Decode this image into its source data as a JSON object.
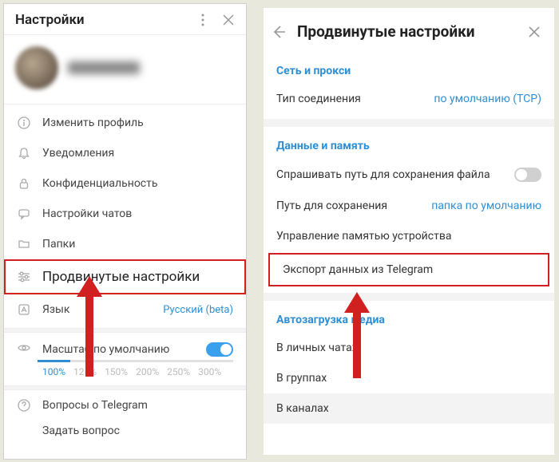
{
  "left": {
    "title": "Настройки",
    "items": {
      "edit_profile": "Изменить профиль",
      "notifications": "Уведомления",
      "privacy": "Конфиденциальность",
      "chat_settings": "Настройки чатов",
      "folders": "Папки",
      "advanced": "Продвинутые настройки",
      "language": "Язык",
      "language_value": "Русский (beta)"
    },
    "scale": {
      "label": "Масштаб по умолчанию",
      "values": [
        "100%",
        "125%",
        "150%",
        "200%",
        "250%",
        "300%"
      ],
      "current_index": 0
    },
    "faq": "Вопросы о Telegram",
    "ask": "Задать вопрос"
  },
  "right": {
    "title": "Продвинутые настройки",
    "network": {
      "section_title": "Сеть и прокси",
      "connection_type": "Тип соединения",
      "connection_value": "по умолчанию (TCP)"
    },
    "data_memory": {
      "section_title": "Данные и память",
      "ask_path": "Спрашивать путь для сохранения файла",
      "download_path": "Путь для сохранения",
      "download_path_value": "папка по умолчанию",
      "manage_storage": "Управление памятью устройства",
      "export": "Экспорт данных из Telegram"
    },
    "automedia": {
      "section_title": "Автозагрузка медиа",
      "private": "В личных чатах",
      "groups": "В группах",
      "channels": "В каналах"
    }
  }
}
